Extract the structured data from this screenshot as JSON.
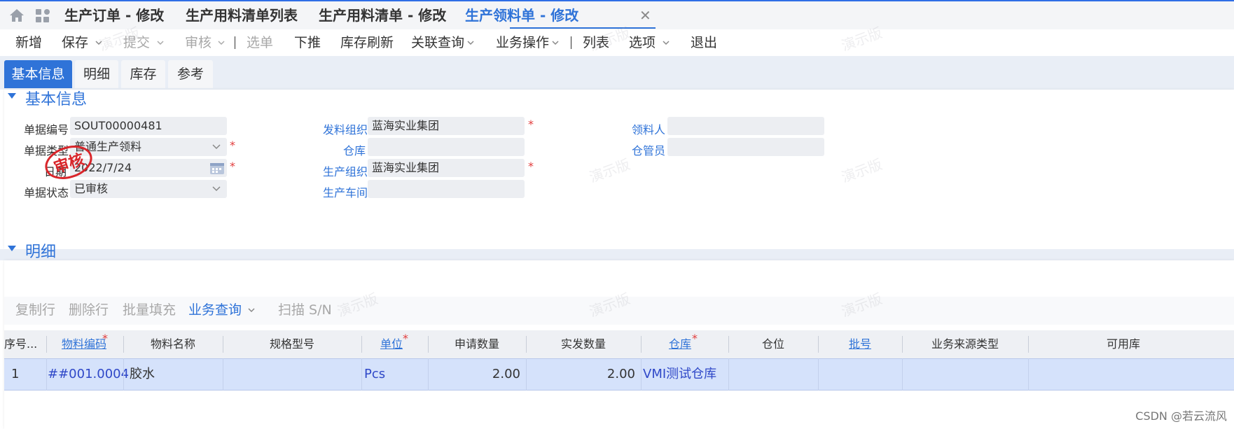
{
  "tabs": [
    {
      "label": "生产订单 - 修改"
    },
    {
      "label": "生产用料清单列表"
    },
    {
      "label": "生产用料清单 - 修改"
    },
    {
      "label": "生产领料单 - 修改"
    }
  ],
  "toolbar": {
    "new": "新增",
    "save": "保存",
    "submit": "提交",
    "audit": "审核",
    "select": "选单",
    "push_down": "下推",
    "refresh_stock": "库存刷新",
    "related_query": "关联查询",
    "business_ops": "业务操作",
    "list": "列表",
    "options": "选项",
    "exit": "退出"
  },
  "page_tabs": [
    "基本信息",
    "明细",
    "库存",
    "参考"
  ],
  "basic_info": {
    "section_title": "基本信息",
    "doc_no_label": "单据编号",
    "doc_no": "SOUT00000481",
    "doc_type_label": "单据类型",
    "doc_type": "普通生产领料",
    "date_label": "日期",
    "date": "2022/7/24",
    "status_label": "单据状态",
    "status": "已审核",
    "issue_org_label": "发料组织",
    "issue_org": "蓝海实业集团",
    "warehouse_label": "仓库",
    "warehouse": "",
    "prod_org_label": "生产组织",
    "prod_org": "蓝海实业集团",
    "workshop_label": "生产车间",
    "workshop": "",
    "picker_label": "领料人",
    "picker": "",
    "keeper_label": "仓管员",
    "keeper": "",
    "stamp_text": "审核"
  },
  "detail": {
    "section_title": "明细",
    "toolbar": {
      "copy_row": "复制行",
      "delete_row": "删除行",
      "batch_fill": "批量填充",
      "business_query": "业务查询",
      "scan": "扫描 S/N"
    },
    "columns": [
      "序号...",
      "物料编码",
      "物料名称",
      "规格型号",
      "单位",
      "申请数量",
      "实发数量",
      "仓库",
      "仓位",
      "批号",
      "业务来源类型",
      "可用库"
    ],
    "rows": [
      {
        "seq": "1",
        "material_code": "##001.0004",
        "material_name": "胶水",
        "spec": "",
        "unit": "Pcs",
        "applied_qty": "2.00",
        "actual_qty": "2.00",
        "warehouse": "VMI测试仓库",
        "location": "",
        "batch": "",
        "source_type": "",
        "available": ""
      }
    ]
  },
  "watermark": "演示版",
  "footer_credit": "CSDN @若云流风",
  "colors": {
    "accent": "#2f73d8",
    "required": "#e23d3d",
    "row_selected": "#d5e2fb"
  }
}
